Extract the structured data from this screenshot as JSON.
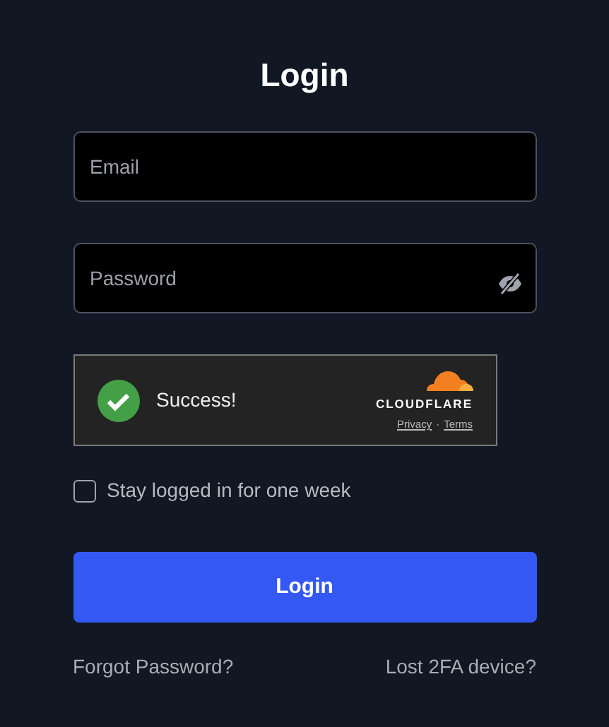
{
  "title": "Login",
  "fields": [
    {
      "placeholder": "Email",
      "kind": "text"
    },
    {
      "placeholder": "Password",
      "kind": "password"
    }
  ],
  "captcha": {
    "status": "Success!",
    "verified": true,
    "brand": "CLOUDFLARE",
    "links": [
      "Privacy",
      "Terms"
    ],
    "separator": "·"
  },
  "remember": {
    "label": "Stay logged in for one week",
    "checked": false
  },
  "submit": "Login",
  "links": [
    "Forgot Password?",
    "Lost 2FA device?"
  ]
}
